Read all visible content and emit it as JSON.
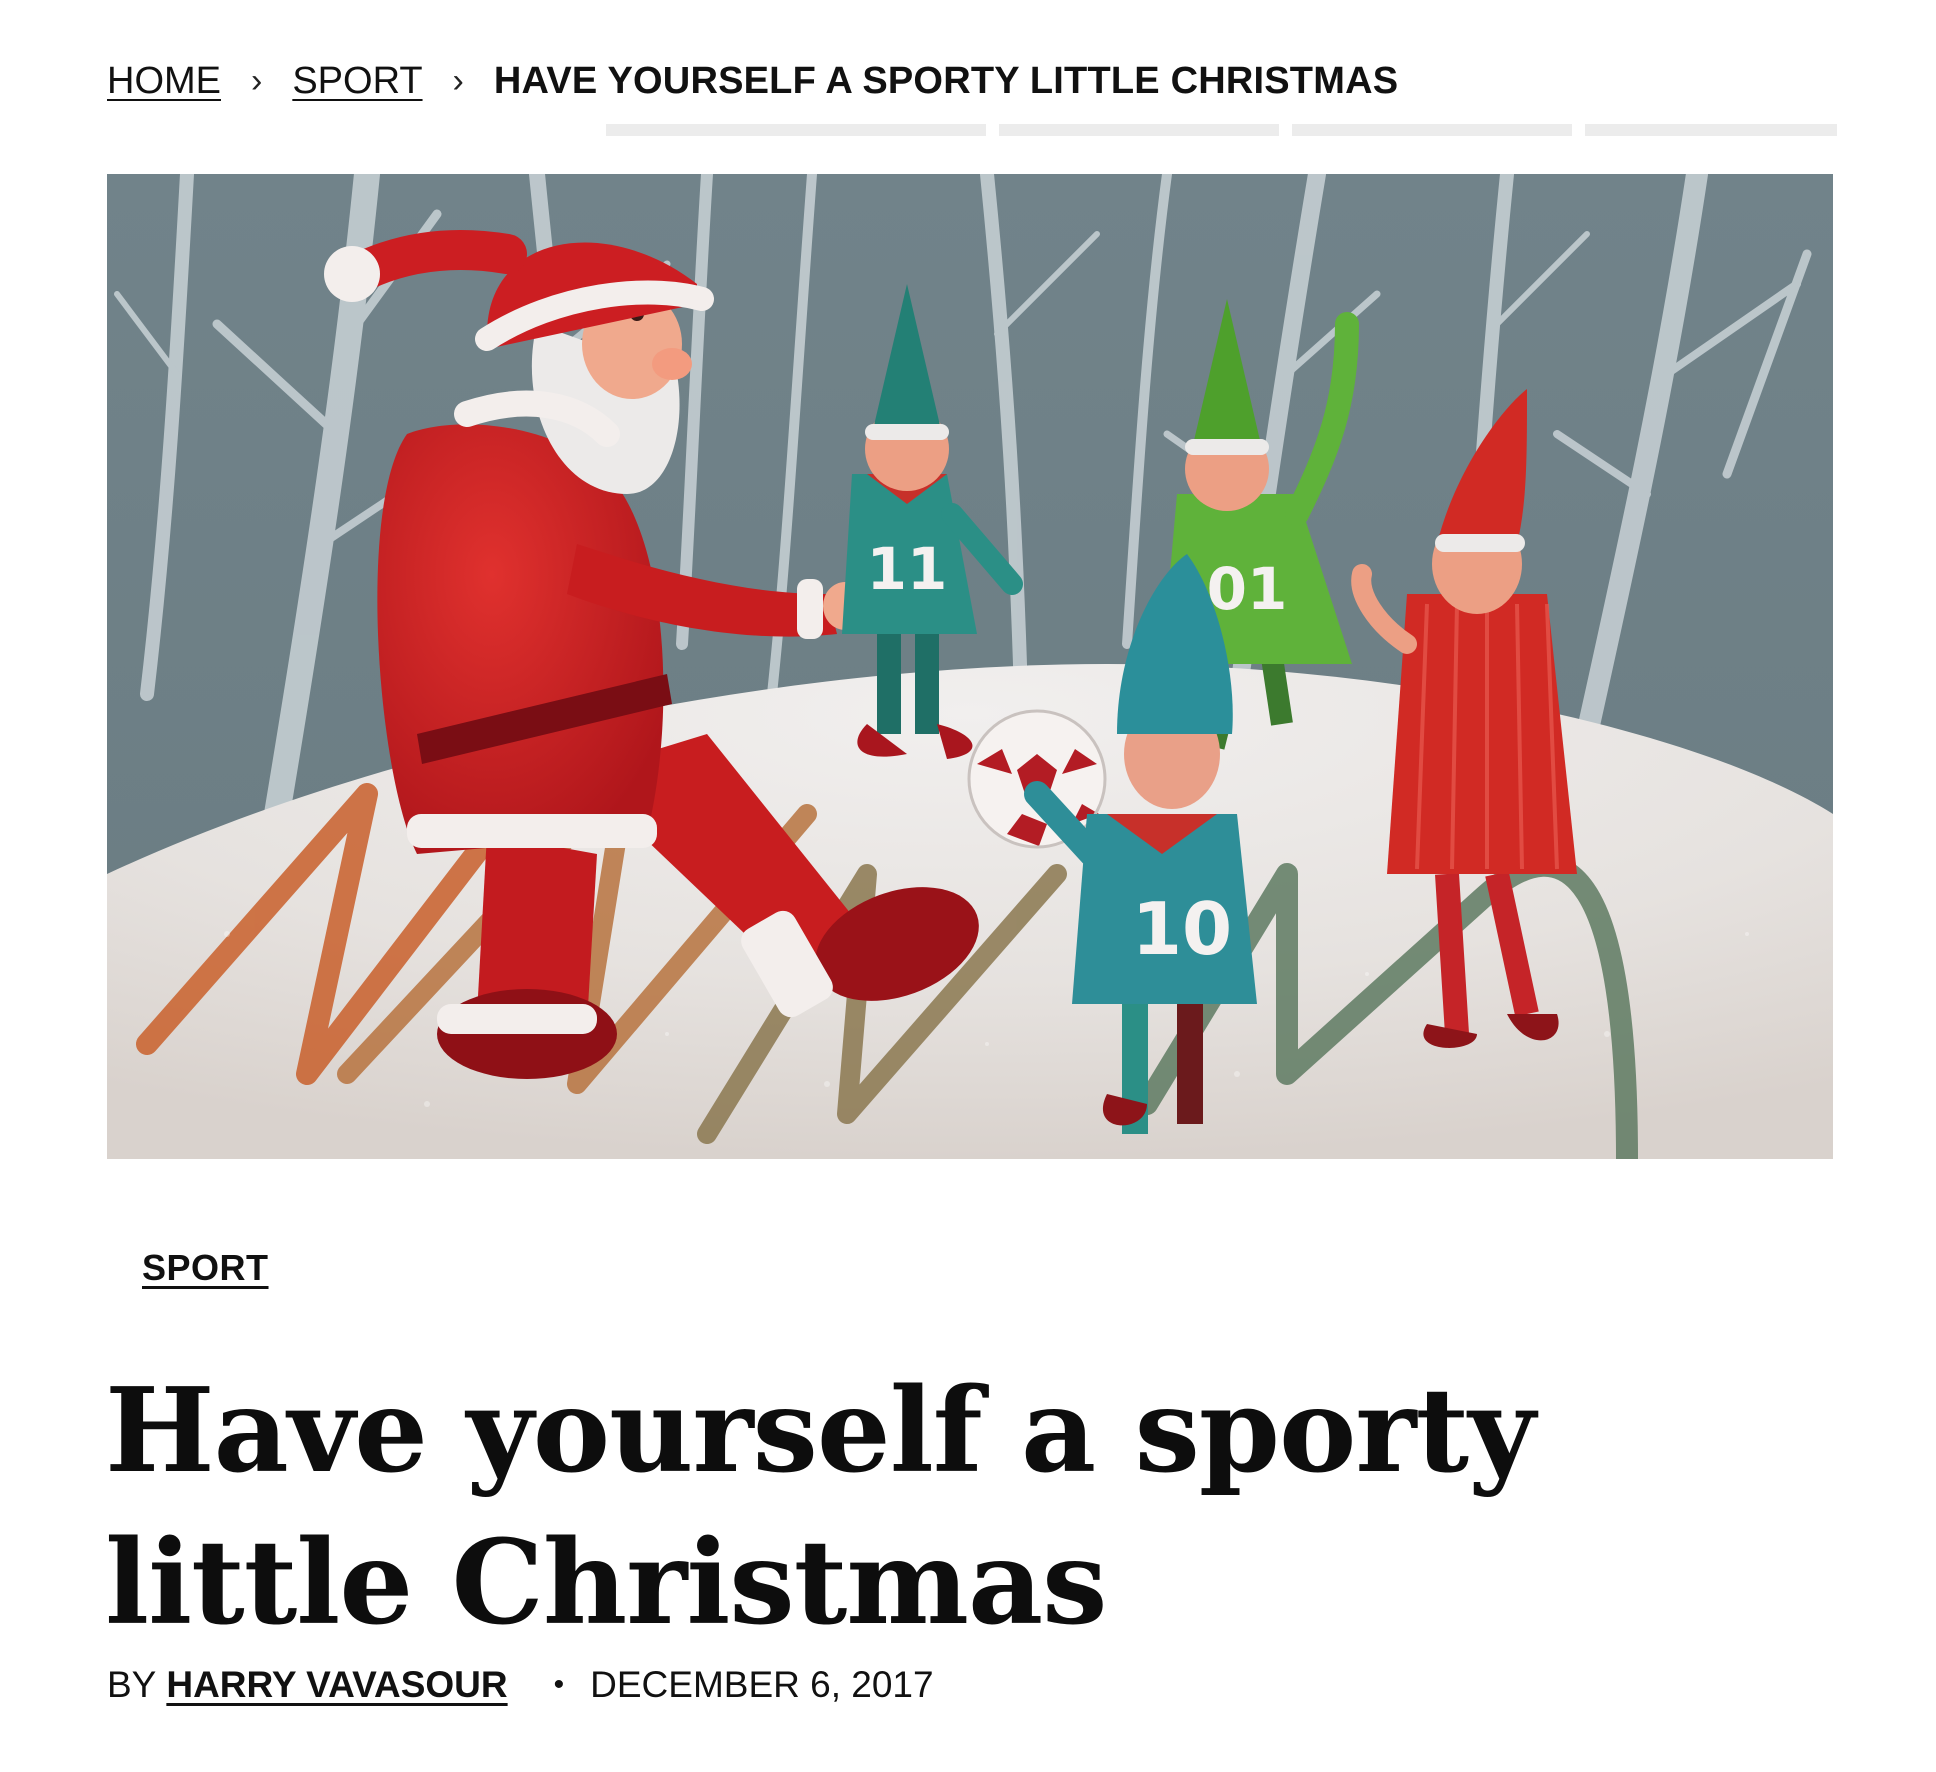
{
  "breadcrumb": {
    "home": "HOME",
    "section": "SPORT",
    "current": "HAVE YOURSELF A SPORTY LITTLE CHRISTMAS",
    "separator": "›"
  },
  "hero": {
    "jersey_numbers": [
      "11",
      "01",
      "10"
    ],
    "colors": {
      "sky": "#6f8087",
      "snow": "#e9e6e4",
      "santa_red": "#c81d1f",
      "elf_teal": "#2b8f86",
      "elf_green": "#5fb23a",
      "elf_red": "#d12a24"
    }
  },
  "article": {
    "category": "SPORT",
    "title": "Have yourself a sporty little Christmas",
    "byline_prefix": "BY",
    "author": "HARRY VAVASOUR",
    "separator": "•",
    "date": "DECEMBER 6, 2017"
  }
}
